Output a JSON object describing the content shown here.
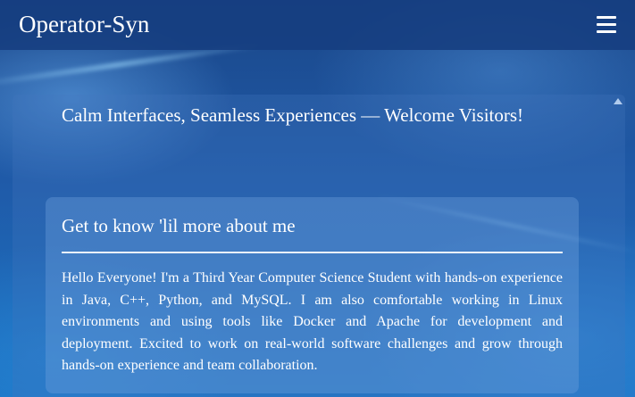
{
  "header": {
    "brand": "Operator-Syn",
    "menu_icon": "hamburger-menu-icon"
  },
  "hero": {
    "welcome_text": "Calm Interfaces, Seamless Experiences — Welcome Visitors!"
  },
  "about": {
    "title": "Get to know 'lil more about me",
    "body": "Hello Everyone! I'm a Third Year Computer Science Student with hands-on experience in Java, C++, Python, and MySQL. I am also comfortable working in Linux environments and using tools like Docker and Apache for development and deployment. Excited to work on real-world software challenges and grow through hands-on experience and team collaboration."
  },
  "colors": {
    "header_bg": "#163e80",
    "page_bg": "#1f5aa8",
    "text": "#ffffff"
  }
}
